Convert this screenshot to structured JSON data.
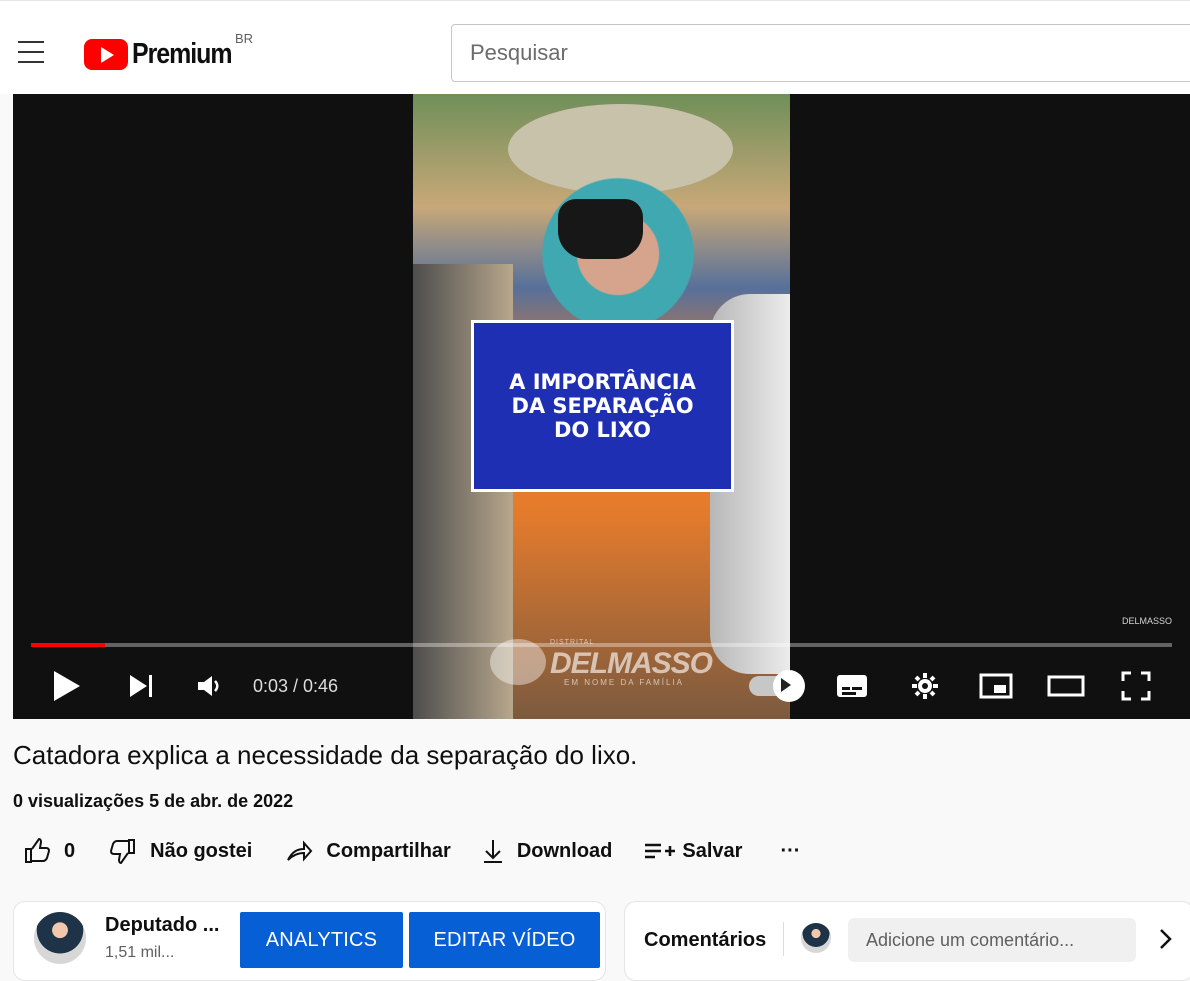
{
  "topbar": {
    "logo_text": "Premium",
    "region": "BR",
    "search_placeholder": "Pesquisar"
  },
  "video": {
    "overlay_title": "A IMPORTÂNCIA\nDA SEPARAÇÃO\nDO LIXO",
    "overlay_brand_small": "DISTRITAL",
    "overlay_brand_main": "DELMASSO",
    "overlay_brand_tag": "EM NOME DA FAMÍLIA",
    "watermark": "DELMASSO",
    "progress_fraction": 0.065,
    "time": "0:03 / 0:46"
  },
  "details": {
    "title": "Catadora explica a necessidade da separação do lixo.",
    "meta": "0 visualizações  5 de abr. de 2022"
  },
  "actions": {
    "like_count": "0",
    "dislike": "Não gostei",
    "share": "Compartilhar",
    "download": "Download",
    "save": "Salvar",
    "more": "···"
  },
  "channel": {
    "name": "Deputado ...",
    "subscribers": "1,51 mil...",
    "analytics_button": "ANALYTICS",
    "edit_button": "EDITAR VÍDEO"
  },
  "comments": {
    "title": "Comentários",
    "placeholder": "Adicione um comentário..."
  }
}
